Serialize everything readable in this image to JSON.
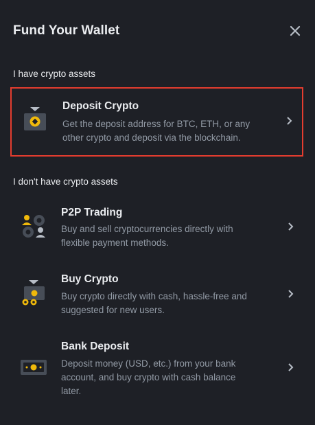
{
  "modal": {
    "title": "Fund Your Wallet",
    "close_icon": "close-icon"
  },
  "sections": {
    "have_crypto": "I have crypto assets",
    "no_crypto": "I don't have crypto assets"
  },
  "options": {
    "deposit_crypto": {
      "title": "Deposit Crypto",
      "desc_line1": "Get the deposit address for BTC, ETH, or any",
      "desc_line2": "other crypto and deposit via the blockchain.",
      "icon": "deposit-crypto-icon",
      "selected": true
    },
    "p2p_trading": {
      "title": "P2P Trading",
      "desc_line1": "Buy and sell cryptocurrencies directly with",
      "desc_line2": "flexible payment methods.",
      "icon": "p2p-trading-icon"
    },
    "buy_crypto": {
      "title": "Buy Crypto",
      "desc_line1": "Buy crypto directly with cash, hassle-free and",
      "desc_line2": "suggested for new users.",
      "icon": "buy-crypto-icon"
    },
    "bank_deposit": {
      "title": "Bank Deposit",
      "desc_line1": "Deposit money (USD, etc.) from your bank",
      "desc_line2": "account, and buy crypto with cash balance",
      "desc_line3": "later.",
      "icon": "bank-deposit-icon"
    }
  },
  "colors": {
    "background": "#1e2026",
    "accent": "#f0b90b",
    "selected_border": "#e53d2f",
    "text_primary": "#eaecef",
    "text_secondary": "#929aa5"
  }
}
